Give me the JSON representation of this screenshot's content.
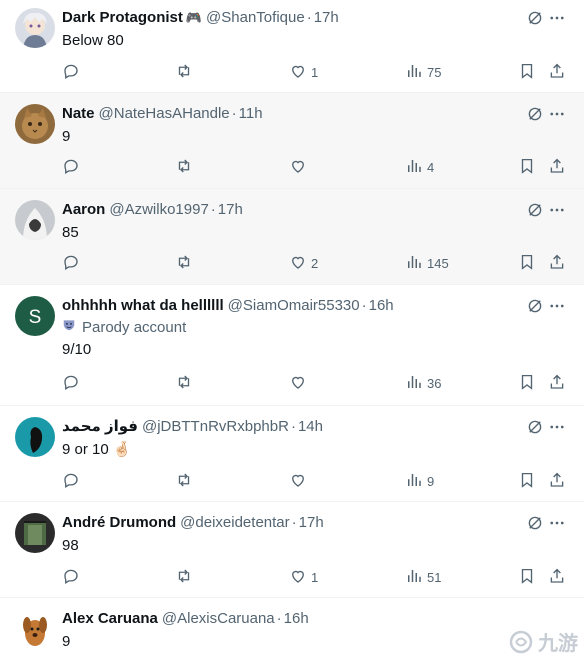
{
  "tweets": [
    {
      "name": "Dark Protagonist",
      "badge": "🎮",
      "handle": "@ShanTofique",
      "time": "17h",
      "text": "Below 80",
      "parody": "",
      "replies": "",
      "reposts": "",
      "likes": "1",
      "views": "75"
    },
    {
      "name": "Nate",
      "badge": "",
      "handle": "@NateHasAHandle",
      "time": "11h",
      "text": "9",
      "parody": "",
      "replies": "",
      "reposts": "",
      "likes": "",
      "views": "4"
    },
    {
      "name": "Aaron",
      "badge": "",
      "handle": "@Azwilko1997",
      "time": "17h",
      "text": "85",
      "parody": "",
      "replies": "",
      "reposts": "",
      "likes": "2",
      "views": "145"
    },
    {
      "name": "ohhhhh what da hellllll",
      "badge": "",
      "handle": "@SiamOmair55330",
      "time": "16h",
      "text": "9/10",
      "parody": "Parody account",
      "replies": "",
      "reposts": "",
      "likes": "",
      "views": "36"
    },
    {
      "name": "فواز محمد",
      "badge": "",
      "handle": "@jDBTTnRvRxbphbR",
      "time": "14h",
      "text": "9 or 10 🤞🏻",
      "parody": "",
      "replies": "",
      "reposts": "",
      "likes": "",
      "views": "9"
    },
    {
      "name": "André Drumond",
      "badge": "",
      "handle": "@deixeidetentar",
      "time": "17h",
      "text": "98",
      "parody": "",
      "replies": "",
      "reposts": "",
      "likes": "1",
      "views": "51"
    },
    {
      "name": "Alex Caruana",
      "badge": "",
      "handle": "@AlexisCaruana",
      "time": "16h",
      "text": "9",
      "parody": "",
      "replies": "",
      "reposts": "",
      "likes": "",
      "views": ""
    }
  ],
  "sep": "·",
  "avatar4_letter": "S",
  "watermark": "九游",
  "icons": {
    "reply": "reply-icon",
    "repost": "repost-icon",
    "like": "heart-icon",
    "views": "views-icon",
    "bookmark": "bookmark-icon",
    "share": "share-icon",
    "grok": "grok-icon",
    "more": "more-icon"
  },
  "colors": {
    "text": "#0f1419",
    "muted": "#536471",
    "border": "#eff3f4",
    "highlight": "#f7f7f7"
  }
}
